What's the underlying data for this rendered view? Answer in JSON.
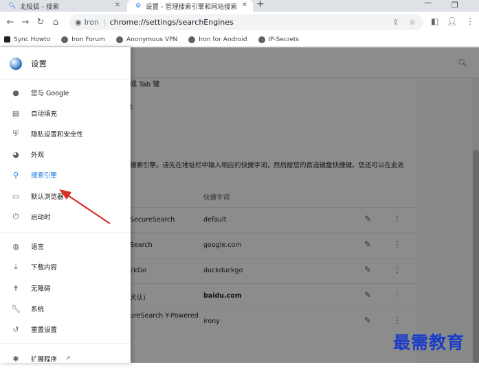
{
  "tabs": [
    {
      "title": "北极狐 - 搜索",
      "icon": "search-icon",
      "active": false
    },
    {
      "title": "设置 - 管理搜索引擎和网站搜索",
      "icon": "gear-icon",
      "active": true
    }
  ],
  "toolbar": {
    "site_name": "Iron",
    "url": "chrome://settings/searchEngines"
  },
  "bookmarks": [
    "Sync Howto",
    "Iron Forum",
    "Anonymous VPN",
    "Iron for Android",
    "IP-Secrets"
  ],
  "drawer": {
    "title": "设置",
    "items": [
      {
        "label": "您与 Google",
        "icon": "person-icon"
      },
      {
        "label": "自动填充",
        "icon": "clipboard-icon"
      },
      {
        "label": "隐私设置和安全性",
        "icon": "shield-icon"
      },
      {
        "label": "外观",
        "icon": "palette-icon"
      },
      {
        "label": "搜索引擎",
        "icon": "search-icon",
        "active": true
      },
      {
        "label": "默认浏览器",
        "icon": "browser-icon"
      },
      {
        "label": "启动时",
        "icon": "power-icon"
      },
      {
        "label": "语言",
        "icon": "globe-icon"
      },
      {
        "label": "下载内容",
        "icon": "download-icon"
      },
      {
        "label": "无障碍",
        "icon": "accessibility-icon"
      },
      {
        "label": "系统",
        "icon": "wrench-icon"
      },
      {
        "label": "重置设置",
        "icon": "restore-icon"
      },
      {
        "label": "扩展程序",
        "icon": "puzzle-icon"
      }
    ]
  },
  "background": {
    "text_tab_key": "或 Tab 键",
    "text_t": "t",
    "text_desc": "搜索引擎。请先在地址栏中输入相应的快捷字词，然后按您的首选键盘快捷键。您还可以在此处",
    "column_shortcut": "快捷字词",
    "rows": [
      {
        "name": "SecureSearch",
        "shortcut": "default",
        "bold": false
      },
      {
        "name": "Search",
        "shortcut": "google.com",
        "bold": false
      },
      {
        "name": "ckGo",
        "shortcut": "duckduckgo",
        "bold": false
      },
      {
        "name": "犬认)",
        "shortcut": "baidu.com",
        "bold": true
      },
      {
        "name": "ureSearch Y-Powered",
        "shortcut": "irony",
        "bold": false
      }
    ]
  },
  "watermark": "最需教育",
  "colors": {
    "accent": "#1a73e8",
    "arrow": "#d93025",
    "watermark": "#1a3cc9"
  }
}
